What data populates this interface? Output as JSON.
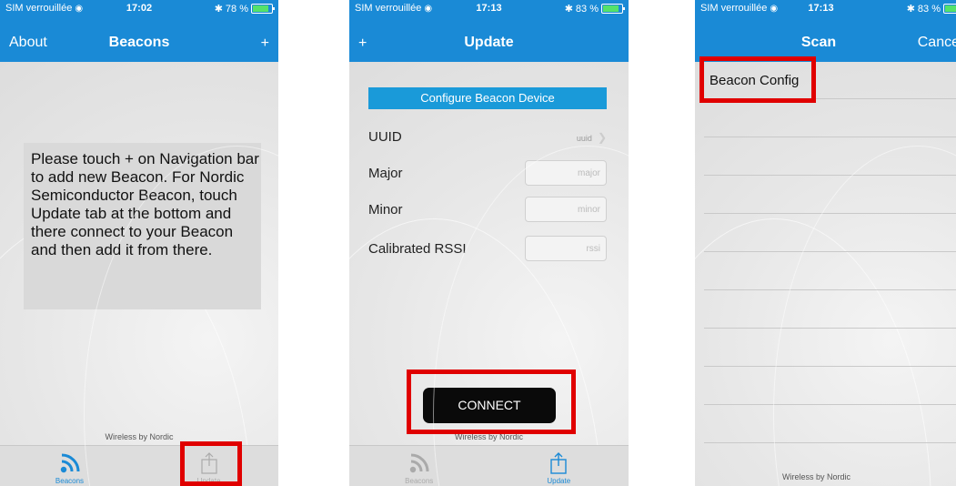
{
  "screens": [
    {
      "status": {
        "carrier": "SIM verrouillée",
        "time": "17:02",
        "battery": "78 %",
        "battery_level": 0.78
      },
      "nav": {
        "left": "About",
        "title": "Beacons",
        "right_icon": "plus-icon"
      },
      "message": "Please touch + on Navigation bar to add new Beacon. For Nordic Semiconductor Beacon, touch Update tab at the bottom and there connect to your Beacon and then add it from there.",
      "footer": "Wireless by Nordic",
      "tabs": [
        {
          "label": "Beacons",
          "icon": "rss-icon",
          "active": true
        },
        {
          "label": "Update",
          "icon": "share-icon",
          "active": false
        }
      ]
    },
    {
      "status": {
        "carrier": "SIM verrouillée",
        "time": "17:13",
        "battery": "83 %",
        "battery_level": 0.83
      },
      "nav": {
        "left_icon": "plus-icon",
        "title": "Update"
      },
      "config_header": "Configure Beacon Device",
      "fields": {
        "uuid": {
          "label": "UUID",
          "value": "uuid"
        },
        "major": {
          "label": "Major",
          "placeholder": "major"
        },
        "minor": {
          "label": "Minor",
          "placeholder": "minor"
        },
        "rssi": {
          "label": "Calibrated RSSI",
          "placeholder": "rssi"
        }
      },
      "connect_label": "CONNECT",
      "footer": "Wireless by Nordic",
      "tabs": [
        {
          "label": "Beacons",
          "icon": "rss-icon",
          "active": false
        },
        {
          "label": "Update",
          "icon": "share-icon",
          "active": true
        }
      ]
    },
    {
      "status": {
        "carrier": "SIM verrouillée",
        "time": "17:13",
        "battery": "83 %",
        "battery_level": 0.83
      },
      "nav": {
        "title": "Scan",
        "right": "Cance"
      },
      "list": [
        "Beacon Config"
      ],
      "footer": "Wireless by Nordic"
    }
  ],
  "colors": {
    "nav_blue": "#1a8ad6",
    "highlight_red": "#e00000"
  }
}
